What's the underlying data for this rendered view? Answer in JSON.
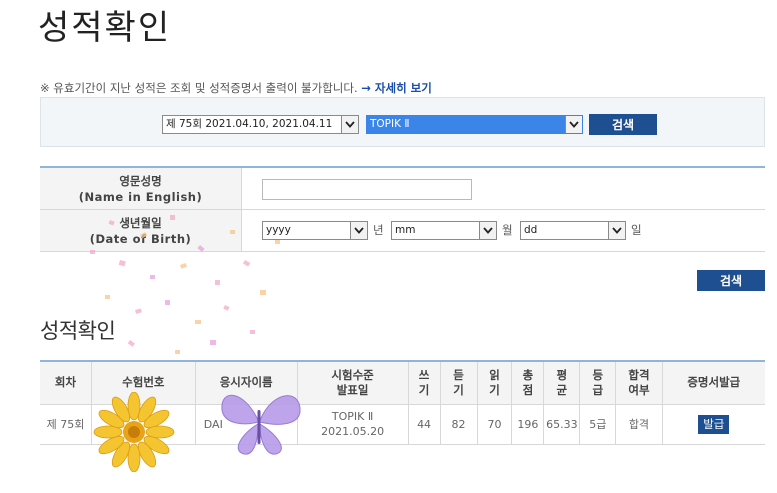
{
  "page": {
    "title": "성적확인"
  },
  "notice": {
    "text": "※ 유효기간이 지난 성적은 조회 및 성적증명서 출력이 불가합니다.",
    "link": "→ 자세히 보기"
  },
  "exam_select": {
    "round_value": "제 75회  2021.04.10, 2021.04.11",
    "level_value": "TOPIK Ⅱ",
    "search_label": "검색"
  },
  "form": {
    "name_label_ko": "영문성명",
    "name_label_en": "(Name in English)",
    "name_value": "",
    "dob_label_ko": "생년월일",
    "dob_label_en": "(Date of Birth)",
    "year_value": "yyyy",
    "year_unit": "년",
    "month_value": "mm",
    "month_unit": "월",
    "day_value": "dd",
    "day_unit": "일",
    "search_label": "검색"
  },
  "results": {
    "title": "성적확인",
    "headers": {
      "round": "회차",
      "exam_number": "수험번호",
      "name": "응시자이름",
      "level_line1": "시험수준",
      "level_line2": "발표일",
      "writing_1": "쓰",
      "writing_2": "기",
      "listening_1": "듣",
      "listening_2": "기",
      "reading_1": "읽",
      "reading_2": "기",
      "total_1": "총",
      "total_2": "점",
      "average_1": "평",
      "average_2": "균",
      "grade_1": "등",
      "grade_2": "급",
      "pass_1": "합격",
      "pass_2": "여부",
      "certificate": "증명서발급"
    },
    "rows": [
      {
        "round": "제 75회",
        "exam_number": "",
        "name": "DAI",
        "level": "TOPIK Ⅱ",
        "announce_date": "2021.05.20",
        "writing": "44",
        "listening": "82",
        "reading": "70",
        "total": "196",
        "average": "65.33",
        "grade": "5급",
        "pass": "합격",
        "issue_label": "발급"
      }
    ]
  },
  "colors": {
    "accent": "#1d4f91",
    "select_highlight": "#3b84e8",
    "table_border": "#8fb5d9"
  }
}
